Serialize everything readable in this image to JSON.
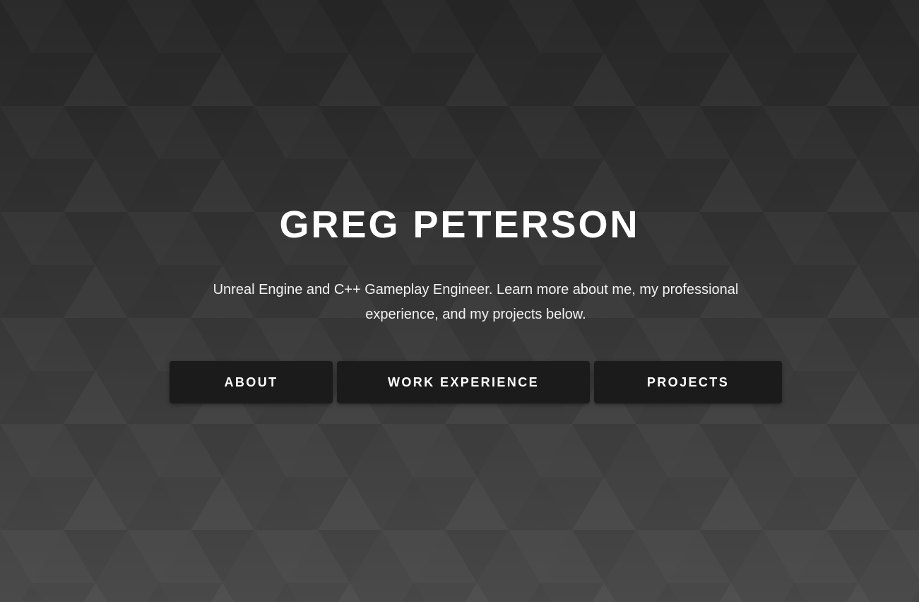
{
  "hero": {
    "title": "GREG PETERSON",
    "subtitle": "Unreal Engine and C++ Gameplay Engineer. Learn more about me, my professional experience, and my projects below."
  },
  "nav": {
    "about_label": "ABOUT",
    "work_label": "WORK EXPERIENCE",
    "projects_label": "PROJECTS"
  },
  "colors": {
    "background_top": "#262626",
    "background_bottom": "#4a4a4a",
    "button_bg": "#1b1b1b",
    "text": "#ffffff"
  }
}
